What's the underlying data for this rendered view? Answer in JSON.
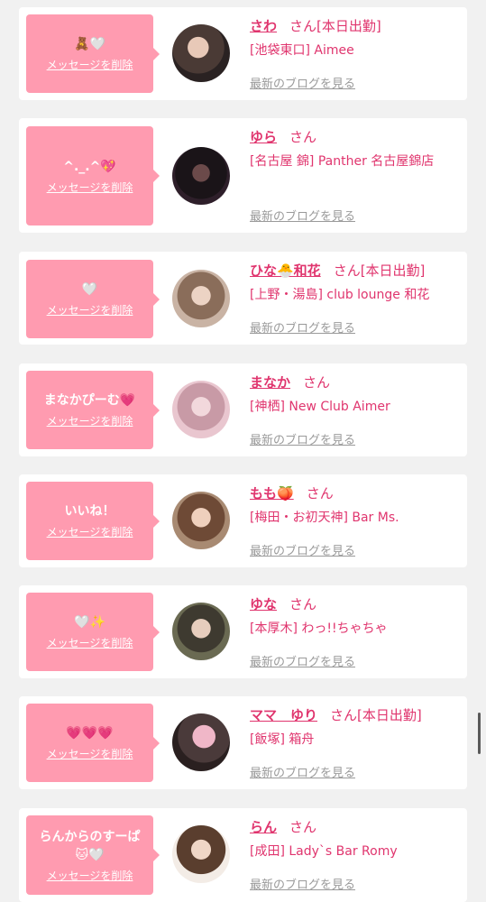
{
  "colors": {
    "accent": "#e0356e",
    "bubble": "#ff9bb0",
    "background": "#f1f1f1",
    "muted": "#9a9a9a"
  },
  "delete_label": "メッセージを削除",
  "blog_label": "最新のブログを見る",
  "honorific": "さん",
  "cards": [
    {
      "message": "🧸🤍",
      "name": "さわ",
      "status": "[本日出勤]",
      "shop": "[池袋東口] Aimee"
    },
    {
      "message": "^._.^💖",
      "name": "ゆら",
      "status": "",
      "shop": "[名古屋 錦] Panther 名古屋錦店"
    },
    {
      "message": "🤍",
      "name": "ひな🐣和花",
      "status": "[本日出勤]",
      "shop": "[上野・湯島] club lounge 和花"
    },
    {
      "message": "まなかぴーむ💗",
      "name": "まなか",
      "status": "",
      "shop": "[神栖] New Club Aimer"
    },
    {
      "message": "いいね！",
      "name": "もも🍑",
      "status": "",
      "shop": "[梅田・お初天神] Bar Ms."
    },
    {
      "message": "🤍✨",
      "name": "ゆな",
      "status": "",
      "shop": "[本厚木] わっ!!ちゃちゃ"
    },
    {
      "message": "💗💗💗",
      "name": "ママ　ゆり",
      "status": "[本日出勤]",
      "shop": "[飯塚] 箱舟"
    },
    {
      "message": "らんからのすーぱ🐱🤍",
      "name": "らん",
      "status": "",
      "shop": "[成田] Lady`s Bar Romy"
    }
  ]
}
